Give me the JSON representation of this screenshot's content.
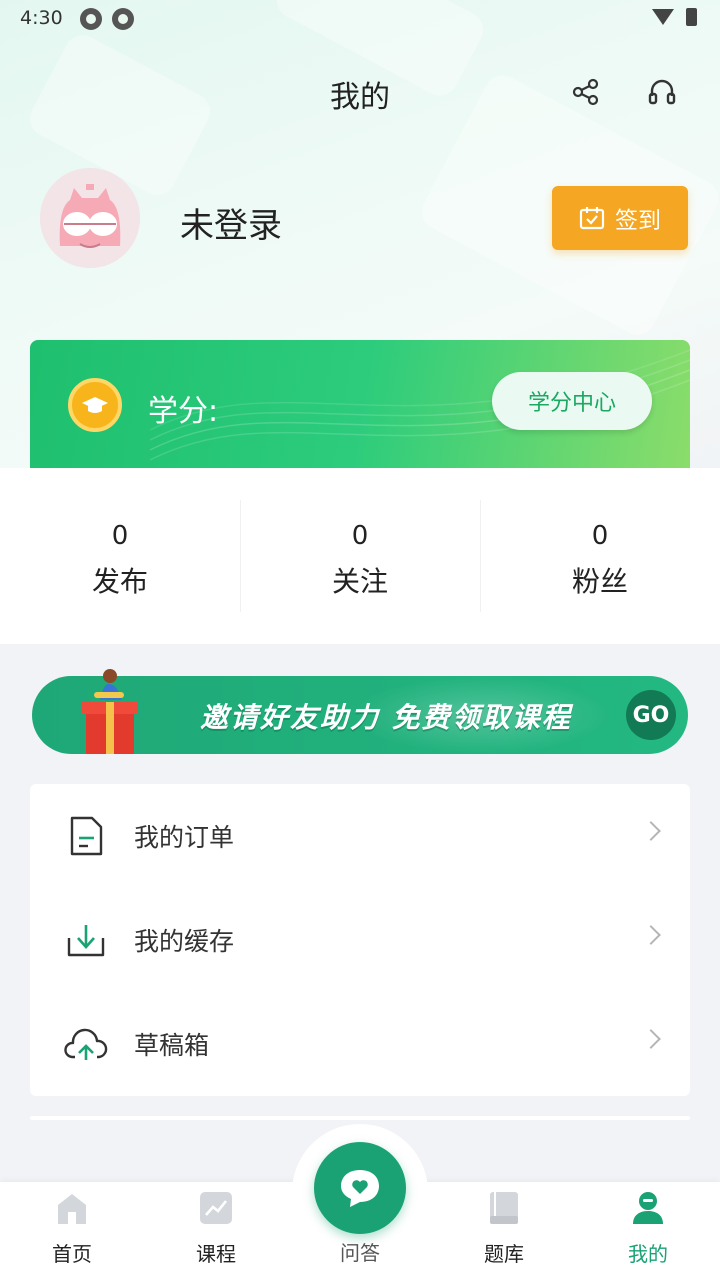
{
  "status_bar": {
    "time": "4:30"
  },
  "header": {
    "title": "我的",
    "share_icon": "share-icon",
    "service_icon": "headset-icon"
  },
  "profile": {
    "login_label": "未登录",
    "checkin_label": "签到"
  },
  "credit": {
    "label": "学分:",
    "center_button": "学分中心"
  },
  "stats": [
    {
      "value": "0",
      "label": "发布"
    },
    {
      "value": "0",
      "label": "关注"
    },
    {
      "value": "0",
      "label": "粉丝"
    }
  ],
  "invite_banner": {
    "text": "邀请好友助力  免费领取课程",
    "go_label": "GO"
  },
  "menu": [
    {
      "label": "我的订单",
      "icon": "order-document-icon"
    },
    {
      "label": "我的缓存",
      "icon": "download-tray-icon"
    },
    {
      "label": "草稿箱",
      "icon": "cloud-upload-icon"
    }
  ],
  "tabs": [
    {
      "label": "首页",
      "icon": "home-icon"
    },
    {
      "label": "课程",
      "icon": "chart-icon"
    },
    {
      "label": "问答",
      "icon": "chat-heart-icon"
    },
    {
      "label": "题库",
      "icon": "book-icon"
    },
    {
      "label": "我的",
      "icon": "person-icon",
      "active": true
    }
  ],
  "colors": {
    "accent": "#1aa274",
    "checkin": "#f5a623",
    "credit_gradient_start": "#1ebf6e",
    "credit_gradient_end": "#8bdd6a"
  }
}
